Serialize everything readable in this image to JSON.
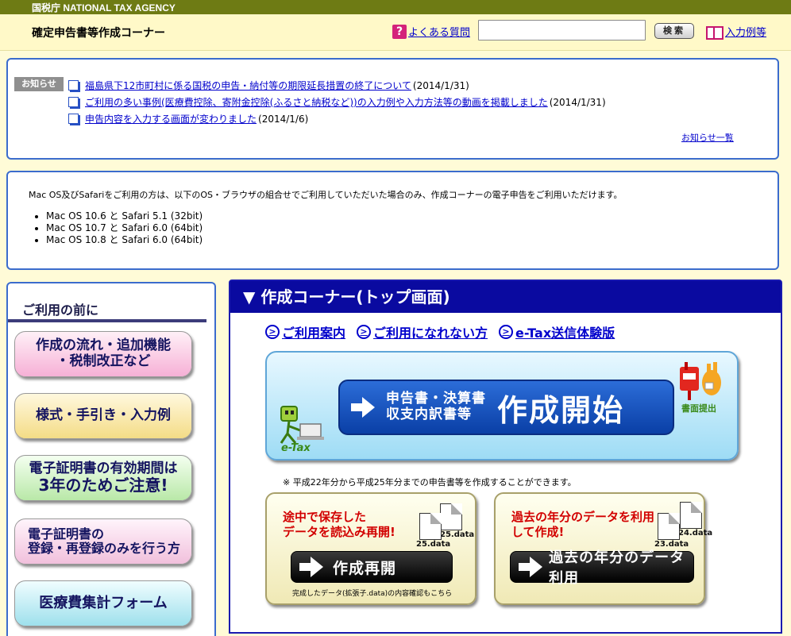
{
  "header": {
    "agency": "国税庁 NATIONAL TAX AGENCY",
    "corner_title": "確定申告書等作成コーナー",
    "faq_icon": "?",
    "faq_label": "よくある質問",
    "search_placeholder": "",
    "search_button": "検索",
    "examples_label": "入力例等"
  },
  "notice": {
    "tag": "お知らせ",
    "items": [
      {
        "text": "福島県下12市町村に係る国税の申告・納付等の期限延長措置の終了について",
        "date": "(2014/1/31)"
      },
      {
        "text": "ご利用の多い事例(医療費控除、寄附金控除(ふるさと納税など))の入力例や入力方法等の動画を掲載しました",
        "date": "(2014/1/31)"
      },
      {
        "text": "申告内容を入力する画面が変わりました",
        "date": "(2014/1/6)"
      }
    ],
    "more": "お知らせ一覧"
  },
  "mac": {
    "intro": "Mac OS及びSafariをご利用の方は、以下のOS・ブラウザの組合せでご利用していただいた場合のみ、作成コーナーの電子申告をご利用いただけます。",
    "items": [
      "Mac OS 10.6 と Safari 5.1 (32bit)",
      "Mac OS 10.7 と Safari 6.0 (64bit)",
      "Mac OS 10.8 と Safari 6.0 (64bit)"
    ]
  },
  "leftnav": {
    "title": "ご利用の前に",
    "flow_line1": "作成の流れ・追加機能",
    "flow_line2": "・税制改正など",
    "forms": "様式・手引き・入力例",
    "cert_line1": "電子証明書の有効期間は",
    "cert_line2": "3年のためご注意!",
    "register_line1": "電子証明書の",
    "register_line2": "登録・再登録のみを行う方",
    "medical": "医療費集計フォーム"
  },
  "main": {
    "heading": "▼ 作成コーナー(トップ画面)",
    "links": [
      "ご利用案内",
      "ご利用になれない方",
      "e-Tax送信体験版"
    ],
    "etax_label": "e-Tax",
    "start_small_line1": "申告書・決算書",
    "start_small_line2": "収支内訳書等",
    "start_big": "作成開始",
    "paper_label": "書面提出",
    "years_note": "※ 平成22年分から平成25年分までの申告書等を作成することができます。",
    "resume": {
      "line1": "途中で保存した",
      "line2": "データを読込み再開!",
      "file_a": "25.data",
      "file_b": "25.data",
      "button": "作成再開",
      "caption": "完成したデータ(拡張子.data)の内容確認もこちら"
    },
    "past": {
      "line1": "過去の年分のデータを利用",
      "line2": "して作成!",
      "file_a": "24.data",
      "file_b": "23.data",
      "button": "過去の年分のデータ利用"
    }
  }
}
